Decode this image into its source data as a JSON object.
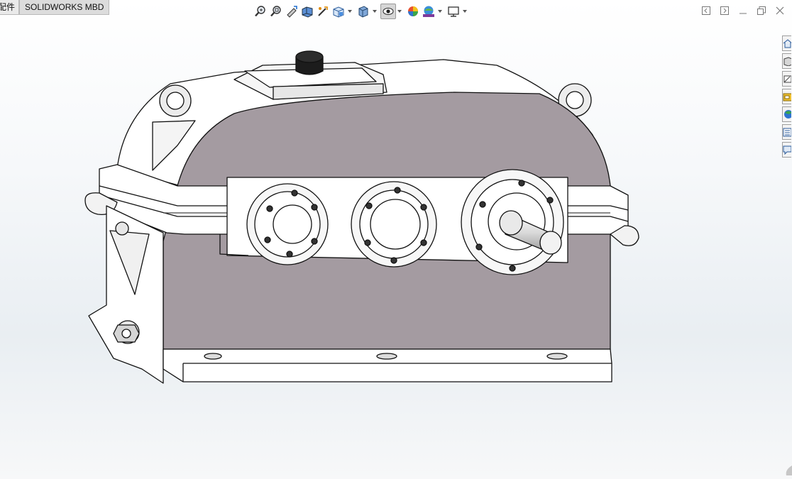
{
  "tabs": [
    {
      "label": "配件",
      "active": false
    },
    {
      "label": "SOLIDWORKS MBD",
      "active": true
    }
  ],
  "heads_up_toolbar": [
    {
      "icon": "zoom-to-fit-icon"
    },
    {
      "icon": "zoom-to-area-icon"
    },
    {
      "icon": "previous-view-icon"
    },
    {
      "icon": "section-view-icon"
    },
    {
      "icon": "dynamic-annotation-views-icon"
    },
    {
      "icon": "view-orientation-icon",
      "dropdown": true
    },
    {
      "icon": "display-style-icon",
      "dropdown": true
    },
    {
      "icon": "hide-show-items-icon",
      "dropdown": true,
      "pressed": true
    },
    {
      "icon": "edit-appearance-icon"
    },
    {
      "icon": "apply-scene-icon",
      "dropdown": true
    },
    {
      "icon": "view-settings-icon",
      "dropdown": true
    }
  ],
  "window_controls": [
    "tile-left-icon",
    "tile-right-icon",
    "minimize-icon",
    "restore-icon",
    "close-icon"
  ],
  "task_pane": [
    "home-icon",
    "resources-icon",
    "design-library-icon",
    "file-explorer-icon",
    "appearances-icon",
    "custom-properties-icon",
    "forum-icon"
  ],
  "colors": {
    "housing_body": "#a49ba1",
    "housing_white": "#ffffff",
    "outline": "#111111",
    "background": "#eef2f5"
  }
}
